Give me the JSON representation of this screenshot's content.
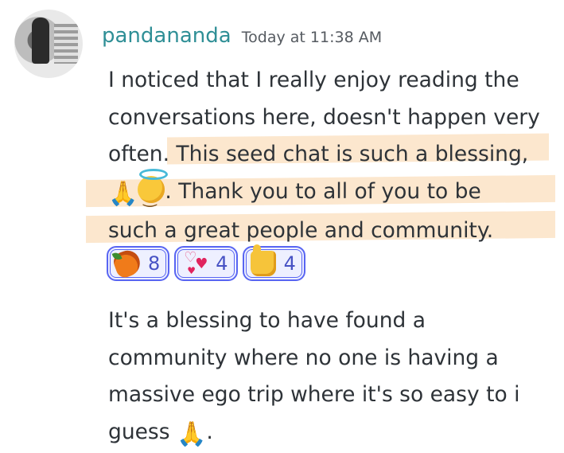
{
  "author": {
    "username": "pandananda",
    "timestamp": "Today at 11:38 AM"
  },
  "message1": {
    "line1": "I noticed that I really enjoy reading the",
    "line2": "conversations here, doesn't happen very",
    "line3_pre": "often",
    "line3_post": ". This seed chat is such a blessing,",
    "line4_post": ". Thank you to all of you to be",
    "line5": "such a great people and community."
  },
  "reactions": [
    {
      "icon": "mango-icon",
      "count": "8"
    },
    {
      "icon": "revolving-hearts-icon",
      "count": "4"
    },
    {
      "icon": "thumbs-up-icon",
      "count": "4"
    }
  ],
  "message2": {
    "line1": "It's a blessing to have found a",
    "line2": "community where no one is having a",
    "line3": "massive ego trip where it's so easy to i",
    "line4_pre": "guess",
    "line4_post": "."
  },
  "emoji": {
    "folded_hands": "folded-hands-icon",
    "smiling_face_with_halo": "smiling-face-with-halo-icon"
  },
  "colors": {
    "username": "#2f8f96",
    "highlight": "#fbe3c6",
    "reaction_border": "#5865f2",
    "reaction_bg": "#eef0ff"
  }
}
